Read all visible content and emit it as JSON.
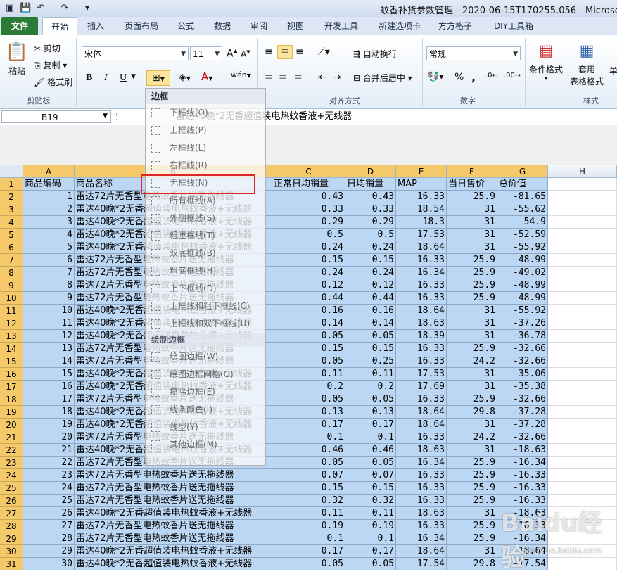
{
  "window": {
    "title": "蚊香补货参数管理 - 2020-06-15T170255.056 - Microsoft Ex"
  },
  "quick_access": {
    "save_icon": "save-icon",
    "undo_icon": "undo-icon",
    "redo_icon": "redo-icon"
  },
  "tabs": [
    {
      "label": "文件"
    },
    {
      "label": "开始"
    },
    {
      "label": "插入"
    },
    {
      "label": "页面布局"
    },
    {
      "label": "公式"
    },
    {
      "label": "数据"
    },
    {
      "label": "审阅"
    },
    {
      "label": "视图"
    },
    {
      "label": "开发工具"
    },
    {
      "label": "新建选项卡"
    },
    {
      "label": "方方格子"
    },
    {
      "label": "DIY工具箱"
    }
  ],
  "ribbon": {
    "clipboard": {
      "paste": "粘贴",
      "cut": "剪切",
      "copy": "复制",
      "format_painter": "格式刷",
      "label": "剪贴板"
    },
    "font": {
      "name": "宋体",
      "size": "11",
      "bold": "B",
      "italic": "I",
      "underline": "U"
    },
    "alignment": {
      "wrap": "自动换行",
      "merge": "合并后居中",
      "label": "对齐方式"
    },
    "number": {
      "format": "常规",
      "percent": "%",
      "comma": ",",
      "label": "数字"
    },
    "styles": {
      "conditional": "条件格式",
      "table": "套用",
      "table2": "表格格式",
      "cell": "单",
      "label": "样式"
    }
  },
  "formula_bar": {
    "name_box": "B19",
    "formula": "雷达40晚*2无香超值装电热蚊香液+无线器"
  },
  "columns": [
    "A",
    "B",
    "C",
    "D",
    "E",
    "F",
    "G",
    "H"
  ],
  "header_row": [
    "商品编码",
    "商品名称",
    "正常日均销量",
    "日均销量",
    "MAP",
    "当日售价",
    "总价值"
  ],
  "rows": [
    [
      "1",
      "雷达72片无香型电热蚊香片送无拖线器",
      "0.43",
      "0.43",
      "16.33",
      "25.9",
      "-81.65"
    ],
    [
      "2",
      "雷达40晚*2无香超值装电热蚊香液+无线器",
      "0.33",
      "0.33",
      "18.54",
      "31",
      "-55.62"
    ],
    [
      "3",
      "雷达40晚*2无香超值装电热蚊香液+无线器",
      "0.29",
      "0.29",
      "18.3",
      "31",
      "-54.9"
    ],
    [
      "4",
      "雷达40晚*2无香超值装电热蚊香液+无线器",
      "0.5",
      "0.5",
      "17.53",
      "31",
      "-52.59"
    ],
    [
      "5",
      "雷达40晚*2无香超值装电热蚊香液+无线器",
      "0.24",
      "0.24",
      "18.64",
      "31",
      "-55.92"
    ],
    [
      "6",
      "雷达72片无香型电热蚊香片送无拖线器",
      "0.15",
      "0.15",
      "16.33",
      "25.9",
      "-48.99"
    ],
    [
      "7",
      "雷达72片无香型电热蚊香片送无拖线器",
      "0.24",
      "0.24",
      "16.34",
      "25.9",
      "-49.02"
    ],
    [
      "8",
      "雷达72片无香型电热蚊香片送无拖线器",
      "0.12",
      "0.12",
      "16.33",
      "25.9",
      "-48.99"
    ],
    [
      "9",
      "雷达72片无香型电热蚊香片送无拖线器",
      "0.44",
      "0.44",
      "16.33",
      "25.9",
      "-48.99"
    ],
    [
      "10",
      "雷达40晚*2无香超值装电热蚊香液+无线器",
      "0.16",
      "0.16",
      "18.64",
      "31",
      "-55.92"
    ],
    [
      "11",
      "雷达40晚*2无香超值装电热蚊香液+无线器",
      "0.14",
      "0.14",
      "18.63",
      "31",
      "-37.26"
    ],
    [
      "12",
      "雷达40晚*2无香超值装电热蚊香液+无线器",
      "0.05",
      "0.05",
      "18.39",
      "31",
      "-36.78"
    ],
    [
      "13",
      "雷达72片无香型电热蚊香片送无拖线器",
      "0.15",
      "0.15",
      "16.33",
      "25.9",
      "-32.66"
    ],
    [
      "14",
      "雷达72片无香型电热蚊香片送无拖线器",
      "0.05",
      "0.25",
      "16.33",
      "24.2",
      "-32.66"
    ],
    [
      "15",
      "雷达40晚*2无香超值装电热蚊香液+无线器",
      "0.11",
      "0.11",
      "17.53",
      "31",
      "-35.06"
    ],
    [
      "16",
      "雷达40晚*2无香超值装电热蚊香液+无线器",
      "0.2",
      "0.2",
      "17.69",
      "31",
      "-35.38"
    ],
    [
      "17",
      "雷达72片无香型电热蚊香片送无拖线器",
      "0.05",
      "0.05",
      "16.33",
      "25.9",
      "-32.66"
    ],
    [
      "18",
      "雷达40晚*2无香超值装电热蚊香液+无线器",
      "0.13",
      "0.13",
      "18.64",
      "29.8",
      "-37.28"
    ],
    [
      "19",
      "雷达40晚*2无香超值装电热蚊香液+无线器",
      "0.17",
      "0.17",
      "18.64",
      "31",
      "-37.28"
    ],
    [
      "20",
      "雷达72片无香型电热蚊香片送无拖线器",
      "0.1",
      "0.1",
      "16.33",
      "24.2",
      "-32.66"
    ],
    [
      "21",
      "雷达40晚*2无香超值装电热蚊香液+无线器",
      "0.46",
      "0.46",
      "18.63",
      "31",
      "-18.63"
    ],
    [
      "22",
      "雷达72片无香型电热蚊香片送无拖线器",
      "0.05",
      "0.05",
      "16.34",
      "25.9",
      "-16.34"
    ],
    [
      "23",
      "雷达72片无香型电热蚊香片送无拖线器",
      "0.07",
      "0.07",
      "16.33",
      "25.9",
      "-16.33"
    ],
    [
      "24",
      "雷达72片无香型电热蚊香片送无拖线器",
      "0.15",
      "0.15",
      "16.33",
      "25.9",
      "-16.33"
    ],
    [
      "25",
      "雷达72片无香型电热蚊香片送无拖线器",
      "0.32",
      "0.32",
      "16.33",
      "25.9",
      "-16.33"
    ],
    [
      "26",
      "雷达40晚*2无香超值装电热蚊香液+无线器",
      "0.11",
      "0.11",
      "18.63",
      "31",
      "-18.63"
    ],
    [
      "27",
      "雷达72片无香型电热蚊香片送无拖线器",
      "0.19",
      "0.19",
      "16.33",
      "25.9",
      "-16.33"
    ],
    [
      "28",
      "雷达72片无香型电热蚊香片送无拖线器",
      "0.1",
      "0.1",
      "16.34",
      "25.9",
      "-16.34"
    ],
    [
      "29",
      "雷达40晚*2无香超值装电热蚊香液+无线器",
      "0.17",
      "0.17",
      "18.64",
      "31",
      "-18.64"
    ],
    [
      "30",
      "雷达40晚*2无香超值装电热蚊香液+无线器",
      "0.05",
      "0.05",
      "17.54",
      "29.8",
      "-17.54"
    ]
  ],
  "border_menu": {
    "heading": "边框",
    "items": [
      {
        "label": "下框线(O)"
      },
      {
        "label": "上框线(P)"
      },
      {
        "label": "左框线(L)"
      },
      {
        "label": "右框线(R)"
      },
      {
        "label": "无框线(N)"
      },
      {
        "label": "所有框线(A)"
      },
      {
        "label": "外侧框线(S)"
      },
      {
        "label": "粗匣框线(T)"
      },
      {
        "label": "双底框线(B)"
      },
      {
        "label": "粗底框线(H)"
      },
      {
        "label": "上下框线(D)"
      },
      {
        "label": "上框线和粗下框线(C)"
      },
      {
        "label": "上框线和双下框线(U)"
      }
    ],
    "draw_heading": "绘制边框",
    "draw_items": [
      {
        "label": "绘图边框(W)"
      },
      {
        "label": "绘图边框网格(G)"
      },
      {
        "label": "擦除边框(E)"
      },
      {
        "label": "线条颜色(I)"
      },
      {
        "label": "线型(Y)"
      },
      {
        "label": "其他边框(M)..."
      }
    ],
    "highlighted_item": "无框线(N)"
  },
  "watermark": {
    "brand": "Baidu经验",
    "url": "jingyan.baidu.com"
  },
  "colors": {
    "selection": "#bcd7f3",
    "header_selected": "#f5c96a",
    "file_tab": "#2a7b35",
    "highlight": "#e02424"
  }
}
